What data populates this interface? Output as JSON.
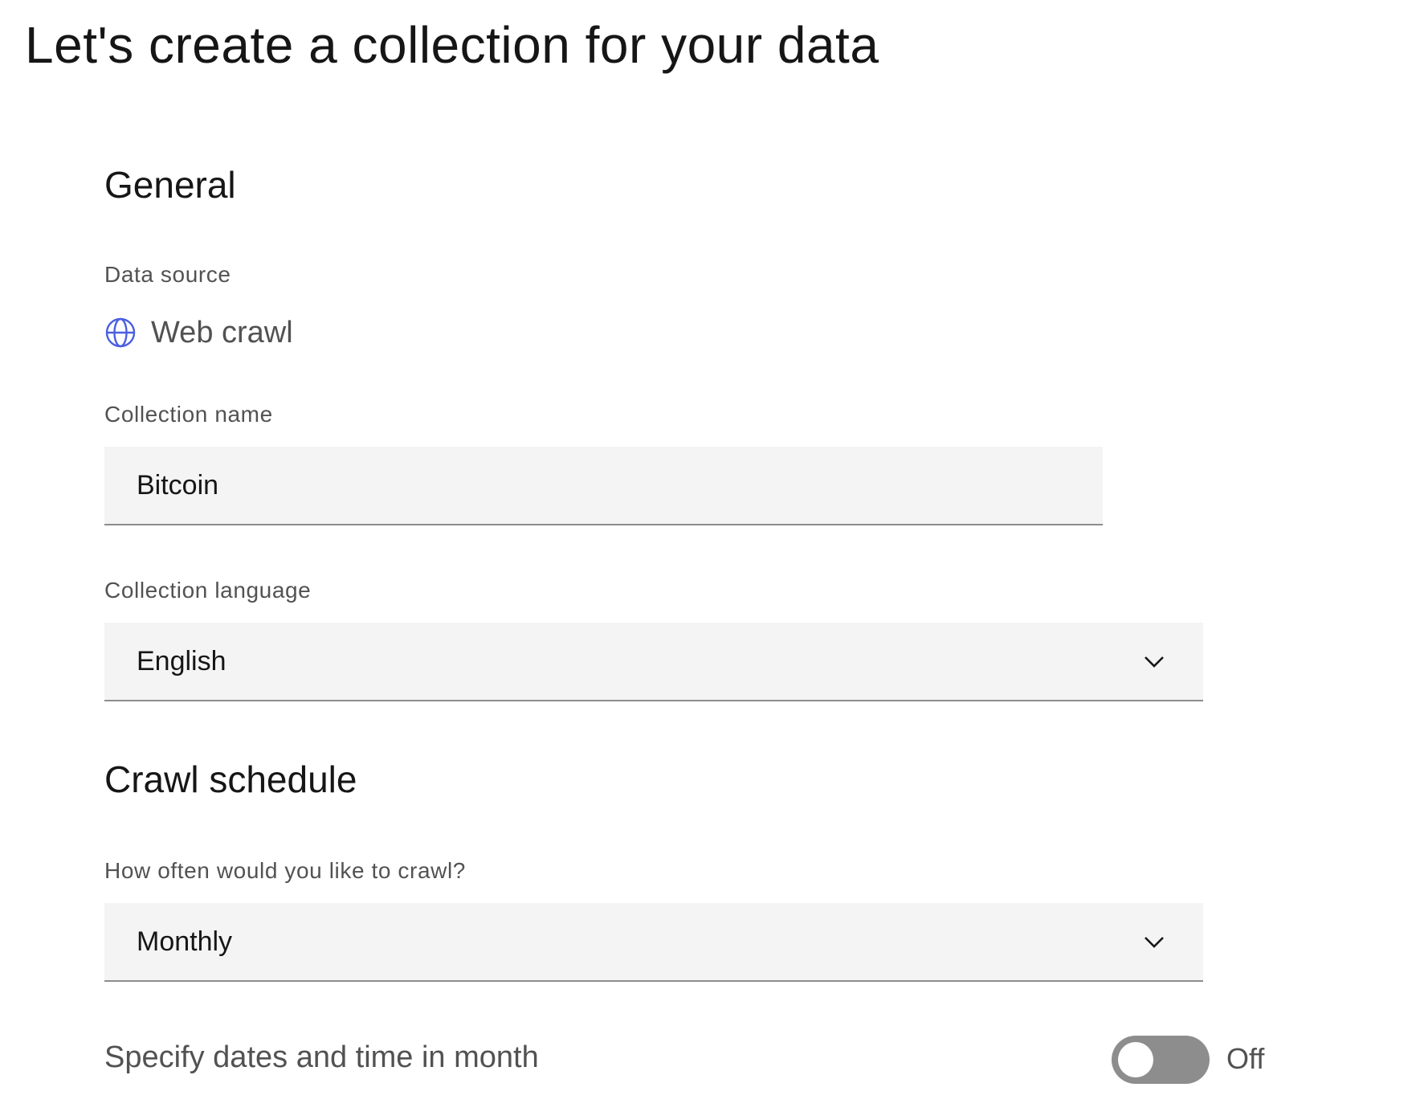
{
  "page": {
    "title": "Let's create a collection for your data"
  },
  "general": {
    "heading": "General",
    "data_source": {
      "label": "Data source",
      "icon": "globe-icon",
      "value": "Web crawl",
      "icon_color": "#4a5fe0"
    },
    "collection_name": {
      "label": "Collection name",
      "value": "Bitcoin"
    },
    "collection_language": {
      "label": "Collection language",
      "selected": "English"
    }
  },
  "crawl_schedule": {
    "heading": "Crawl schedule",
    "frequency": {
      "label": "How often would you like to crawl?",
      "selected": "Monthly"
    },
    "specify_dates": {
      "label": "Specify dates and time in month",
      "state_text": "Off",
      "enabled": false
    }
  },
  "colors": {
    "field_background": "#f4f4f4",
    "field_border": "#8d8d8d",
    "toggle_off": "#8d8d8d",
    "label_text": "#525252",
    "primary_text": "#161616"
  }
}
